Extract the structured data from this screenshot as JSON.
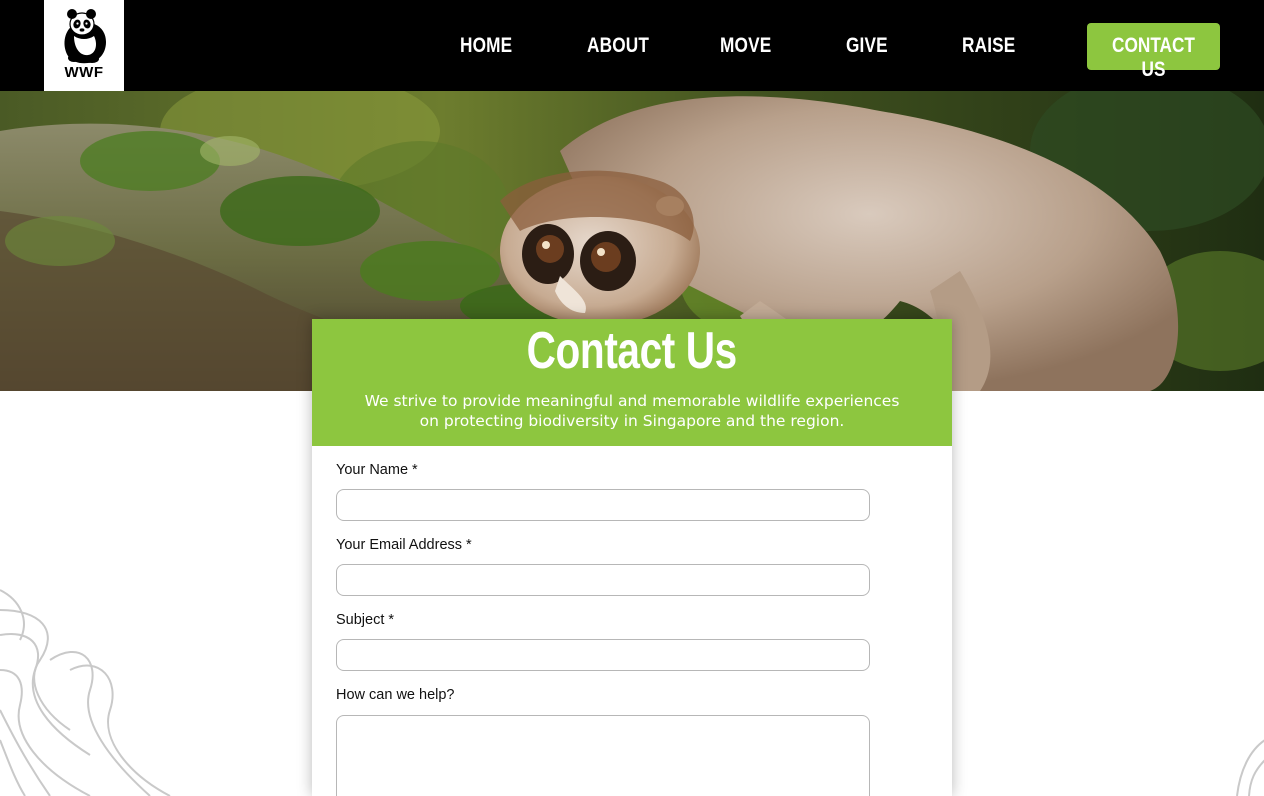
{
  "header": {
    "logo_text": "WWF",
    "nav": [
      {
        "label": "HOME"
      },
      {
        "label": "ABOUT"
      },
      {
        "label": "MOVE"
      },
      {
        "label": "GIVE"
      },
      {
        "label": "RAISE"
      }
    ],
    "contact_button": "CONTACT US"
  },
  "hero": {
    "image": "slow-loris-on-mossy-branch"
  },
  "form": {
    "title": "Contact Us",
    "subtitle_line1": "We strive to provide meaningful and memorable wildlife experiences",
    "subtitle_line2": "on protecting biodiversity in Singapore and the region.",
    "fields": [
      {
        "label": "Your Name *",
        "value": "",
        "placeholder": ""
      },
      {
        "label": "Your Email Address *",
        "value": "",
        "placeholder": ""
      },
      {
        "label": "Subject *",
        "value": "",
        "placeholder": ""
      },
      {
        "label": "How can we help?",
        "value": "",
        "placeholder": ""
      }
    ]
  },
  "colors": {
    "accent_green": "#8dc63f",
    "header_bg": "#000000",
    "text": "#111111"
  },
  "icons": [
    "wwf-panda-logo",
    "contour-lines-decoration"
  ]
}
